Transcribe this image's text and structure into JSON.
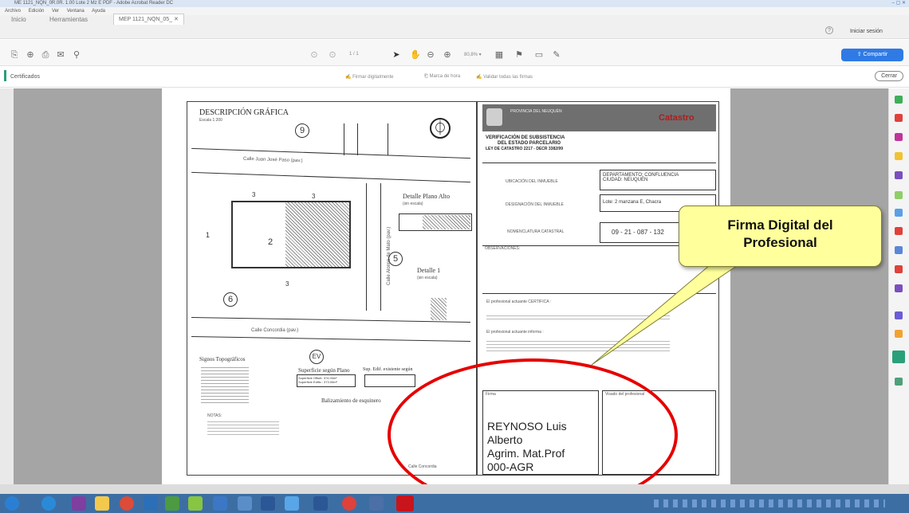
{
  "window": {
    "title": "ME 1121_NQN_0R.0R. 1.00 Lote 2 Mz E PDF - Adobe Acrobat Reader DC",
    "controls": "– ▢ ✕"
  },
  "menu": [
    "Archivo",
    "Edición",
    "Ver",
    "Ventana",
    "Ayuda"
  ],
  "tabs": {
    "home": "Inicio",
    "tools": "Herramientas",
    "document": "MEP 1121_NQN_05_ ✕"
  },
  "header": {
    "help": "?",
    "signin": "Iniciar sesión",
    "share": "Compartir"
  },
  "toolbar": {
    "page_indicator": "1 / 1",
    "zoom": "80,8% ▾"
  },
  "cert_bar": {
    "label": "Certificados",
    "actions": [
      "Firmar digitalmente",
      "Marca de hora",
      "Validar todas las firmas"
    ],
    "close": "Cerrar"
  },
  "document": {
    "left": {
      "title": "DESCRIPCIÓN GRÁFICA",
      "scale": "Escala 1:200",
      "street_top": "Calle Juan José Paso (pav.)",
      "street_bottom": "Calle Concordia (pav.)",
      "street_right": "Calle Alonso de Mato (pav.)",
      "detail_title": "Detalle Plano Alto",
      "detail_small": "(sin escala)",
      "detail1_title": "Detalle 1",
      "detail1_small": "(sin escala)",
      "lot_main": "2",
      "lot_left": "1",
      "lot_top_a": "3",
      "lot_top_b": "3",
      "lot_bottom": "3",
      "circle_top": "9",
      "circle_left": "6",
      "circle_right": "5",
      "circle_bottom": "EV",
      "signs_title": "Signos Topográficos",
      "surface_title": "Superficie según Plano",
      "surface_values": [
        "Superficie Offset: 374.00m²",
        "Superficie Edific.: 373.00m²"
      ],
      "sup_edif_title": "Sup. Edif. existente según",
      "balizamiento": "Balizamiento de esquinero",
      "notas": "NOTAS:",
      "street_inset": "Calle Concordia"
    },
    "right": {
      "org_name": "PROVINCIA DEL NEUQUÉN",
      "catastro": "Catastro",
      "heading_1": "VERIFICACIÓN DE SUBSISTENCIA",
      "heading_2": "DEL ESTADO PARCELARIO",
      "heading_3": "LEY DE CATASTRO 2217 - DECR 3382/99",
      "ubicacion_label": "UBICACIÓN DEL INMUEBLE",
      "ubicacion_value_1": "DEPARTAMENTO: CONFLUENCIA",
      "ubicacion_value_2": "CIUDAD: NEUQUÉN",
      "designacion_label": "DESIGNACIÓN DEL INMUEBLE",
      "designacion_value": "Lote: 2 manzana E, Chacra",
      "nomenclatura_label": "NOMENCLATURA CATASTRAL",
      "nomenclatura_value": "09 - 21 - 087 - 132",
      "observaciones": "OBSERVACIONES:",
      "certifica": "El profesional actuante CERTIFICA :",
      "informa": "El profesional actuante informa :",
      "firma_small": "Firma",
      "visado_small": "Visado del profesional",
      "signer_lines": [
        "REYNOSO Luis",
        "Alberto",
        "Agrim. Mat.Prof",
        "000-AGR"
      ]
    }
  },
  "annotation": {
    "callout_line1": "Firma Digital del",
    "callout_line2": "Profesional"
  }
}
